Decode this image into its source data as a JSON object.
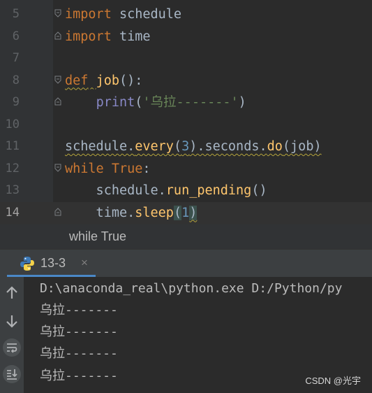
{
  "editor": {
    "lines": [
      {
        "num": "5",
        "tokens": [
          "import",
          " schedule"
        ]
      },
      {
        "num": "6",
        "tokens": [
          "import",
          " time"
        ]
      },
      {
        "num": "7",
        "tokens": []
      },
      {
        "num": "8",
        "tokens": [
          "def",
          " ",
          "job",
          "():"
        ]
      },
      {
        "num": "9",
        "tokens": [
          "    ",
          "print",
          "(",
          "'乌拉-------'",
          ")"
        ]
      },
      {
        "num": "10",
        "tokens": []
      },
      {
        "num": "11",
        "tokens": [
          "schedule.",
          "every",
          "(",
          "3",
          ").seconds.",
          "do",
          "(job)"
        ]
      },
      {
        "num": "12",
        "tokens": [
          "while",
          " ",
          "True",
          ":"
        ]
      },
      {
        "num": "13",
        "tokens": [
          "    schedule.",
          "run_pending",
          "()"
        ]
      },
      {
        "num": "14",
        "tokens": [
          "    time.",
          "sleep",
          "(",
          "1",
          ")"
        ]
      }
    ],
    "current_line": "14"
  },
  "breadcrumb": {
    "text": "while True"
  },
  "run_window": {
    "tab_label": "13-3",
    "tab_close": "×",
    "icons": [
      "python-icon",
      "arrow-up-icon",
      "arrow-down-icon",
      "soft-wrap-icon",
      "scroll-to-end-icon"
    ],
    "accent_color": "#4a88c7"
  },
  "console": {
    "command": "D:\\anaconda_real\\python.exe D:/Python/py",
    "output_lines": [
      "乌拉-------",
      "乌拉-------",
      "乌拉-------",
      "乌拉-------"
    ]
  },
  "watermark": "CSDN @光宇"
}
